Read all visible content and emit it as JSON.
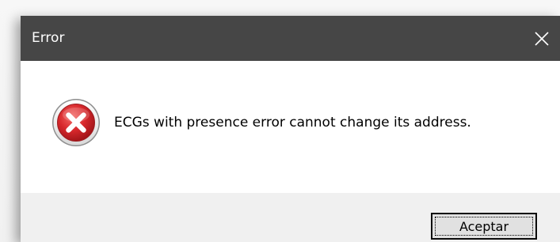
{
  "dialog": {
    "title": "Error",
    "close_icon": "close-icon",
    "error_icon": "error-x-icon",
    "message": "ECGs with presence error cannot change its address.",
    "ok_button_label": "Aceptar"
  },
  "colors": {
    "titlebar": "#464646",
    "title_text": "#ffffff",
    "content_bg": "#ffffff",
    "footer_bg": "#f0f0f0",
    "error_red": "#d8282c"
  }
}
